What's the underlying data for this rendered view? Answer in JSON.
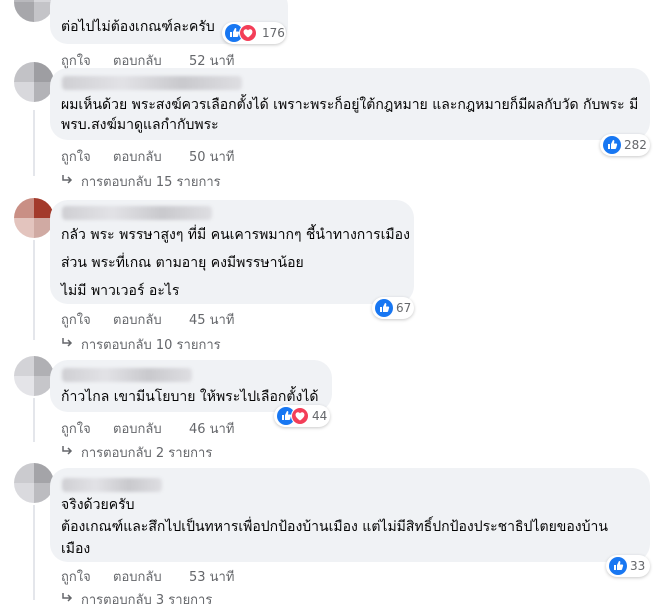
{
  "comments": [
    {
      "lines": [
        "ต่อไปไม่ต้องเกณฑ์ละครับ"
      ],
      "like": "ถูกใจ",
      "reply": "ตอบกลับ",
      "time": "52 นาที",
      "reactions": "176"
    },
    {
      "lines": [
        "ผมเห็นด้วย พระสงฆ์ควรเลือกตั้งได้ เพราะพระก็อยู่ใต้กฎหมาย และกฎหมายก็มีผลกับวัด กับพระ มี",
        "พรบ.สงฆ์มาดูแลกำกับพระ"
      ],
      "like": "ถูกใจ",
      "reply": "ตอบกลับ",
      "time": "50 นาที",
      "reactions": "282",
      "replies_text": "การตอบกลับ 15 รายการ"
    },
    {
      "lines": [
        "กลัว พระ พรรษาสูงๆ ที่มี คนเคารพมากๆ ชี้นำทางการเมือง",
        "ส่วน พระที่เกณ ตามอายุ คงมีพรรษาน้อย",
        "ไม่มี พาวเวอร์ อะไร"
      ],
      "like": "ถูกใจ",
      "reply": "ตอบกลับ",
      "time": "45 นาที",
      "reactions": "67",
      "replies_text": "การตอบกลับ 10 รายการ"
    },
    {
      "lines": [
        "ก้าวไกล เขามีนโยบาย ให้พระไปเลือกตั้งได้"
      ],
      "like": "ถูกใจ",
      "reply": "ตอบกลับ",
      "time": "46 นาที",
      "reactions": "44",
      "replies_text": "การตอบกลับ 2 รายการ"
    },
    {
      "lines": [
        "จริงด้วยครับ",
        "ต้องเกณฑ์และสึกไปเป็นทหารเพื่อปกป้องบ้านเมือง แต่ไม่มีสิทธิ์ปกป้องประชาธิปไตยของบ้าน",
        "เมือง"
      ],
      "like": "ถูกใจ",
      "reply": "ตอบกลับ",
      "time": "53 นาที",
      "reactions": "33",
      "replies_text": "การตอบกลับ 3 รายการ"
    }
  ],
  "colors": {
    "bubble": "#f0f2f5",
    "meta_text": "#65676b",
    "like_blue": "#1877f2",
    "love_red": "#f33e58"
  },
  "icons": {
    "like": "thumbs-up-icon",
    "love": "heart-icon",
    "reply_arrow": "reply-arrow-icon"
  }
}
